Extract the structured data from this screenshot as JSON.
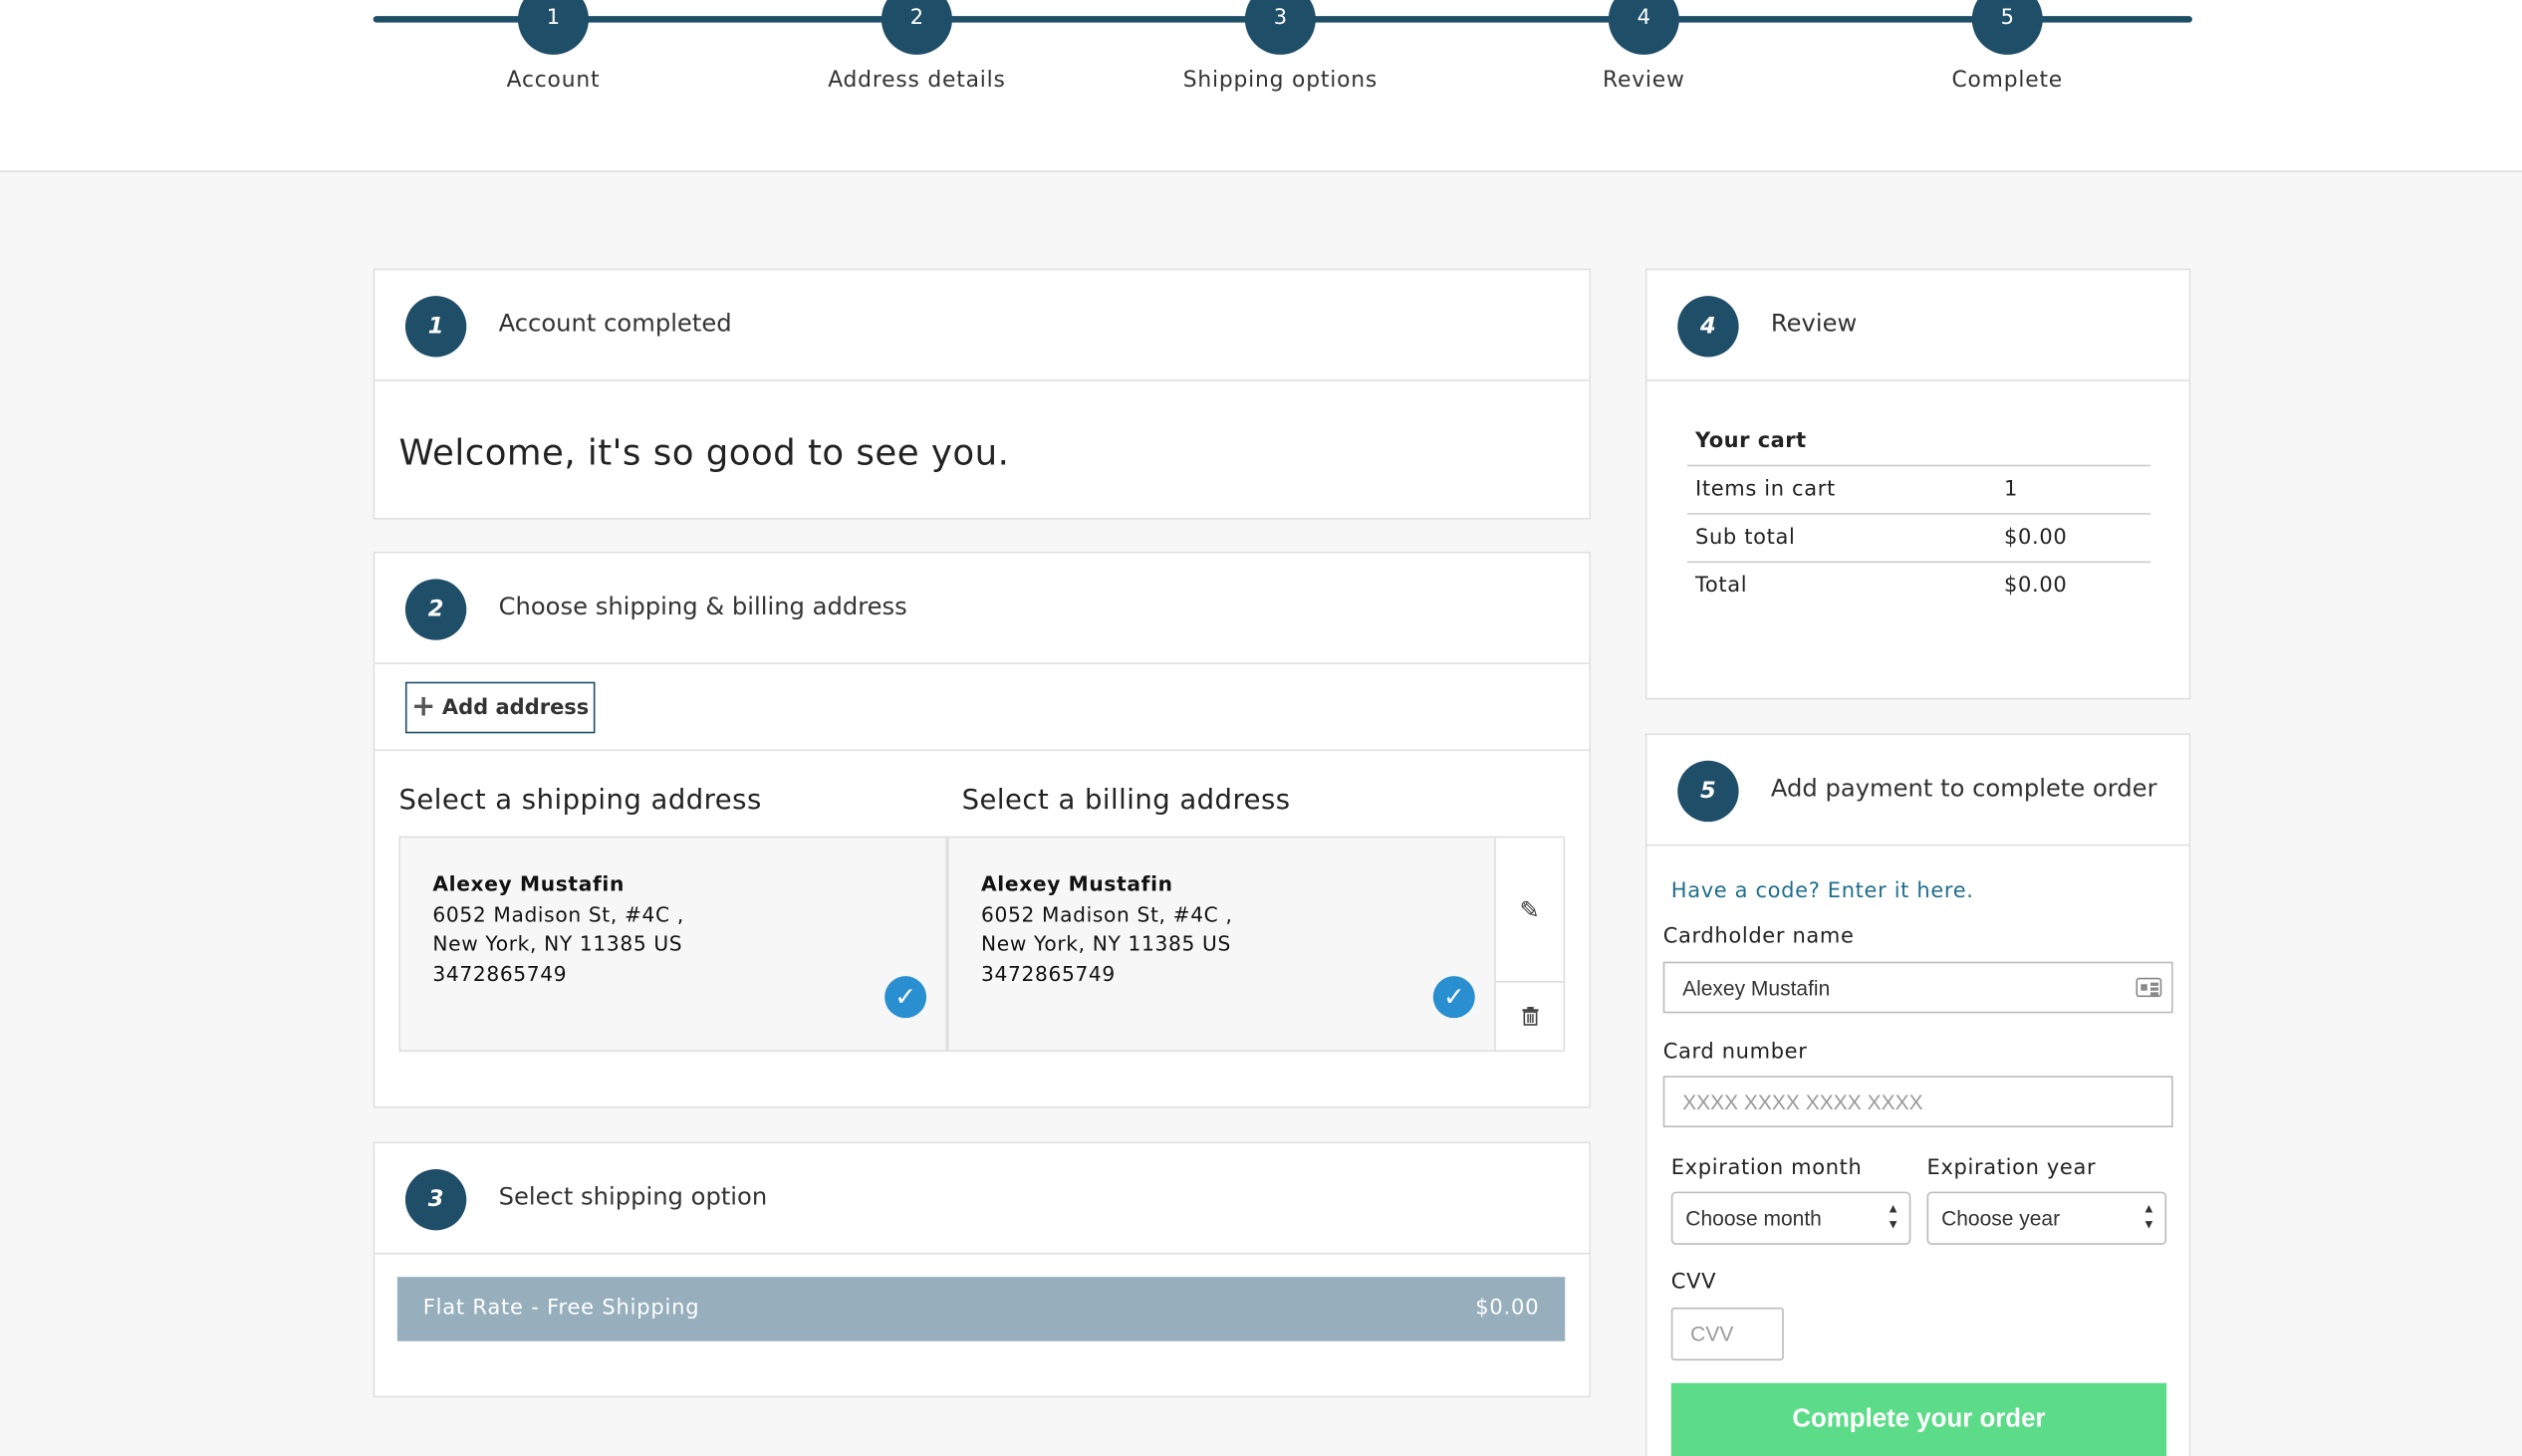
{
  "progress": {
    "steps": [
      {
        "number": "1",
        "label": "Account"
      },
      {
        "number": "2",
        "label": "Address details"
      },
      {
        "number": "3",
        "label": "Shipping options"
      },
      {
        "number": "4",
        "label": "Review"
      },
      {
        "number": "5",
        "label": "Complete"
      }
    ]
  },
  "account": {
    "number": "1",
    "title": "Account completed",
    "welcome": "Welcome, it's so good to see you."
  },
  "address": {
    "number": "2",
    "title": "Choose shipping & billing address",
    "add_button_label": "Add address",
    "shipping_heading": "Select a shipping address",
    "billing_heading": "Select a billing address",
    "shipping": {
      "name": "Alexey Mustafin",
      "line1": "6052 Madison St, #4C ,",
      "line2": "New York, NY 11385 US",
      "phone": "3472865749"
    },
    "billing": {
      "name": "Alexey Mustafin",
      "line1": "6052 Madison St, #4C ,",
      "line2": "New York, NY 11385 US",
      "phone": "3472865749"
    }
  },
  "shipping_option": {
    "number": "3",
    "title": "Select shipping option",
    "option_name": "Flat Rate - Free Shipping",
    "option_price": "$0.00"
  },
  "review": {
    "number": "4",
    "title": "Review",
    "cart_title": "Your cart",
    "rows": [
      {
        "label": "Items in cart",
        "value": "1"
      },
      {
        "label": "Sub total",
        "value": "$0.00"
      },
      {
        "label": "Total",
        "value": "$0.00"
      }
    ]
  },
  "payment": {
    "number": "5",
    "title": "Add payment to complete order",
    "promo_link": "Have a code? Enter it here.",
    "cardholder_label": "Cardholder name",
    "cardholder_value": "Alexey Mustafin",
    "card_number_label": "Card number",
    "card_number_placeholder": "XXXX XXXX XXXX XXXX",
    "exp_month_label": "Expiration month",
    "exp_month_value": "Choose month",
    "exp_year_label": "Expiration year",
    "exp_year_value": "Choose year",
    "cvv_label": "CVV",
    "cvv_placeholder": "CVV",
    "submit_label": "Complete your order"
  },
  "colors": {
    "primary": "#1f4e68",
    "check": "#2a8fd0",
    "shipping_option_bg": "#97afbc",
    "submit_bg": "#5cdc88"
  }
}
